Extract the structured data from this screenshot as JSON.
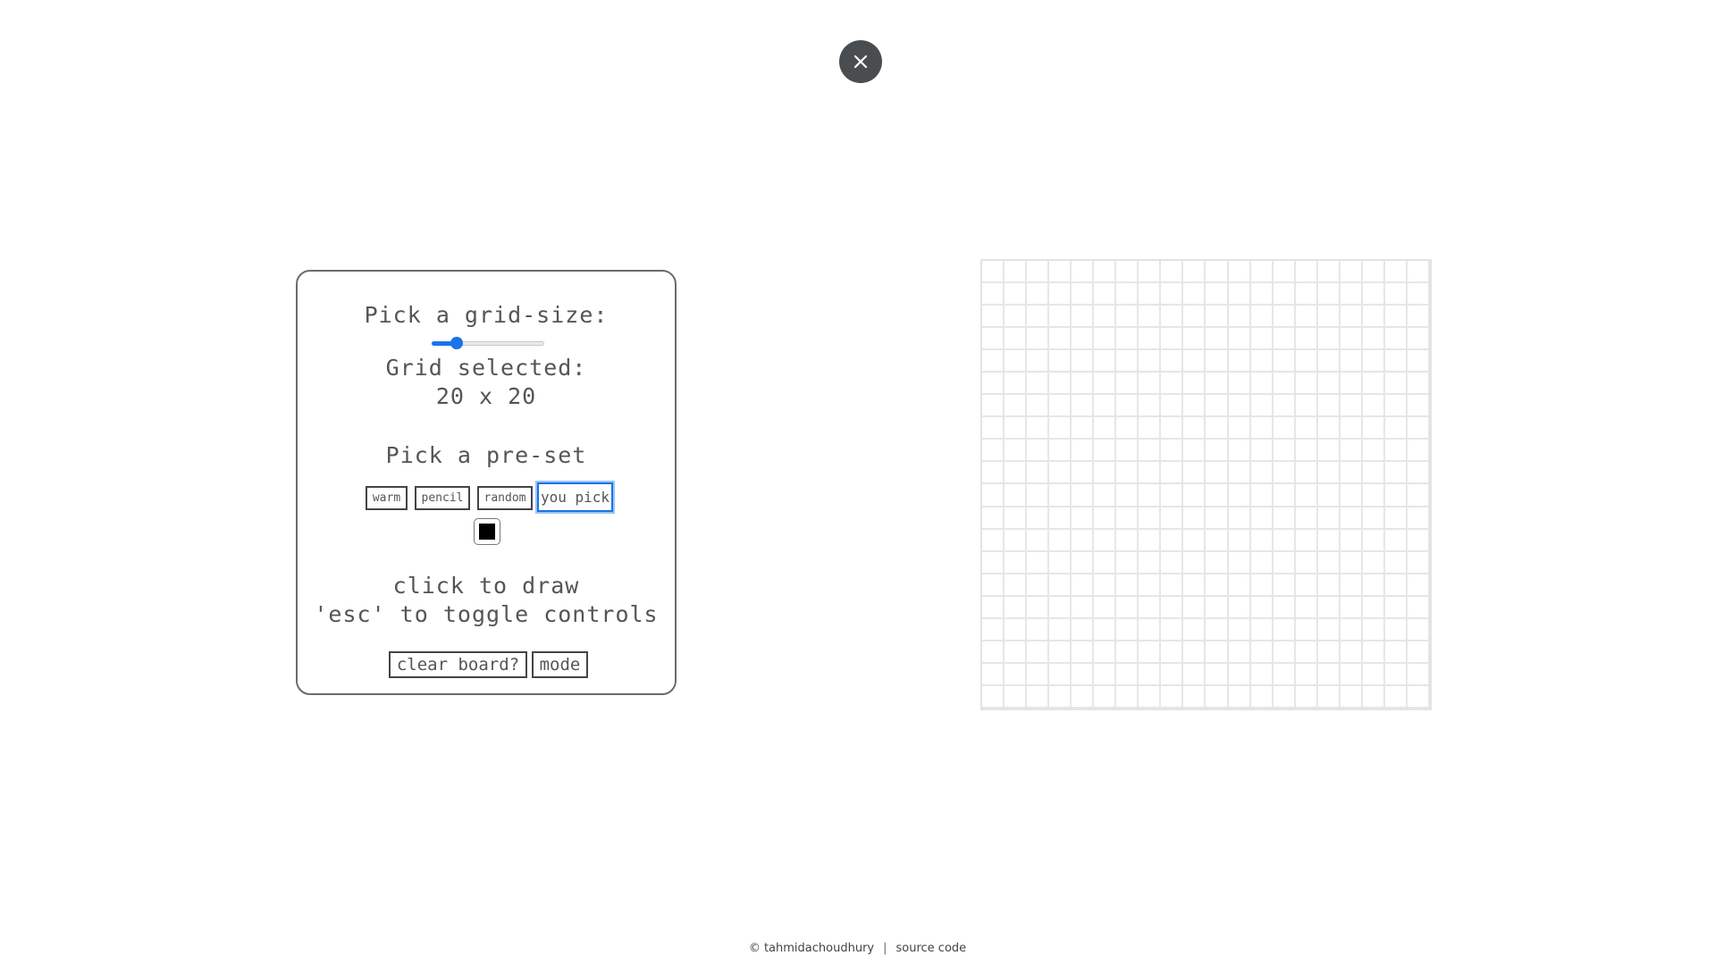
{
  "close": {
    "icon": "close-icon"
  },
  "panel": {
    "grid_size_label": "Pick a grid-size:",
    "slider": {
      "min": 1,
      "max": 100,
      "value": 20,
      "accent": "#1a73e8"
    },
    "grid_selected_label": "Grid selected:",
    "grid_selected_value": "20 x 20",
    "preset_label": "Pick a pre-set",
    "presets": [
      {
        "label": "warm",
        "active": false
      },
      {
        "label": "pencil",
        "active": false
      },
      {
        "label": "random",
        "active": false
      },
      {
        "label": "you pick",
        "active": true
      }
    ],
    "color_value": "#000000",
    "instructions_1": "click to draw",
    "instructions_2": "'esc' to toggle controls",
    "clear_label": "clear board?",
    "mode_label": "mode"
  },
  "grid": {
    "rows": 20,
    "cols": 20
  },
  "footer": {
    "copyright": "© tahmidachoudhury",
    "separator": "|",
    "source_label": "source code"
  }
}
